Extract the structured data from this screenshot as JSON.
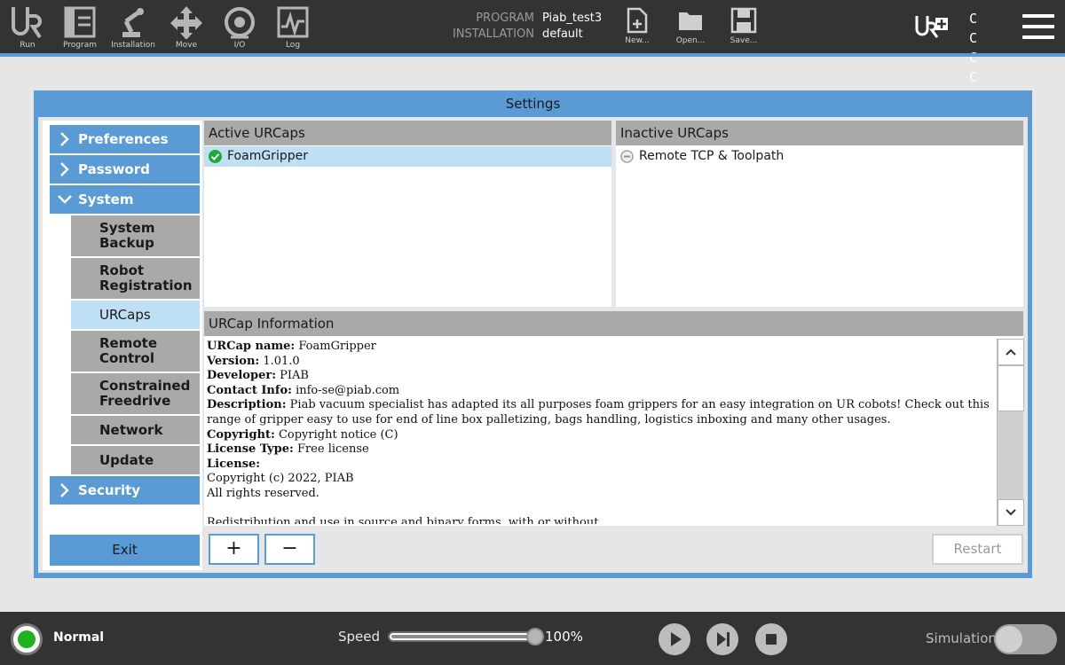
{
  "topbar": {
    "nav": [
      {
        "label": "Run",
        "icon": "ur-logo-icon"
      },
      {
        "label": "Program",
        "icon": "program-icon"
      },
      {
        "label": "Installation",
        "icon": "installation-icon"
      },
      {
        "label": "Move",
        "icon": "move-icon"
      },
      {
        "label": "I/O",
        "icon": "io-icon"
      },
      {
        "label": "Log",
        "icon": "log-icon"
      }
    ],
    "program_label": "PROGRAM",
    "program_value": "Piab_test3",
    "installation_label": "INSTALLATION",
    "installation_value": "default",
    "file_buttons": [
      {
        "label": "New...",
        "icon": "new-file-icon"
      },
      {
        "label": "Open...",
        "icon": "open-folder-icon"
      },
      {
        "label": "Save...",
        "icon": "save-icon"
      }
    ],
    "urplus_icon": "ur-plus-icon",
    "cc_text": [
      "C C",
      "C C"
    ],
    "menu_icon": "hamburger-menu-icon"
  },
  "dialog": {
    "title": "Settings",
    "sidebar": {
      "items": [
        {
          "label": "Preferences",
          "icon": "chevron-right-icon"
        },
        {
          "label": "Password",
          "icon": "chevron-right-icon"
        },
        {
          "label": "System",
          "icon": "chevron-down-icon"
        },
        {
          "label": "Security",
          "icon": "chevron-right-icon"
        }
      ],
      "system_subitems": [
        {
          "label": "System Backup"
        },
        {
          "label": "Robot Registration"
        },
        {
          "label": "URCaps",
          "active": true
        },
        {
          "label": "Remote Control"
        },
        {
          "label": "Constrained Freedrive"
        },
        {
          "label": "Network"
        },
        {
          "label": "Update"
        }
      ],
      "exit_label": "Exit"
    },
    "active_urcaps": {
      "header": "Active URCaps",
      "items": [
        {
          "name": "FoamGripper",
          "status_icon": "check-circle-icon",
          "selected": true
        }
      ]
    },
    "inactive_urcaps": {
      "header": "Inactive URCaps",
      "items": [
        {
          "name": "Remote TCP & Toolpath",
          "status_icon": "minus-circle-icon"
        }
      ]
    },
    "info": {
      "header": "URCap Information",
      "fields": [
        {
          "key": "URCap name:",
          "value": "FoamGripper"
        },
        {
          "key": "Version:",
          "value": "1.01.0"
        },
        {
          "key": "Developer:",
          "value": "PIAB"
        },
        {
          "key": "Contact Info:",
          "value": "info-se@piab.com"
        },
        {
          "key": "Description:",
          "value": "Piab vacuum specialist has adapted its all purposes foam grippers for an easy integration on UR cobots! Check out this range of gripper easy to use for end of line box palletizing, bags handling, logistics inboxing and many other usages."
        },
        {
          "key": "Copyright:",
          "value": "Copyright notice (C)"
        },
        {
          "key": "License Type:",
          "value": "Free license"
        },
        {
          "key": "License:",
          "value": ""
        }
      ],
      "license_lines": [
        "Copyright (c) 2022, PIAB",
        "All rights reserved."
      ],
      "license_continued": "Redistribution and use in source and binary forms, with or without"
    },
    "buttons": {
      "add": "+",
      "remove": "−",
      "restart": "Restart"
    }
  },
  "bottombar": {
    "status": "Normal",
    "status_color": "#20b020",
    "speed_label": "Speed",
    "speed_value": "100%",
    "speed_fraction": 1.0,
    "controls": [
      "play-icon",
      "step-icon",
      "stop-icon"
    ],
    "simulation_label": "Simulation",
    "simulation_on": false
  },
  "colors": {
    "accent": "#5b9bd5",
    "bar": "#333333",
    "selected": "#bfdff5",
    "header_gray": "#a9a9a9"
  }
}
